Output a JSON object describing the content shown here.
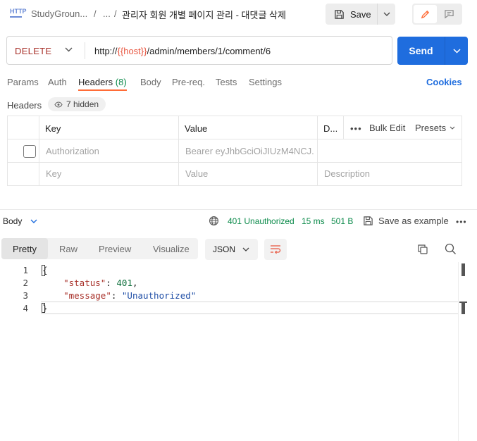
{
  "breadcrumb": {
    "http_badge": "HTTP",
    "collection": "StudyGroun...",
    "separator": "/",
    "ellipsis": "...",
    "request_title": "관리자 회원 개별 페이지 관리 - 대댓글 삭제"
  },
  "toolbar": {
    "save_label": "Save"
  },
  "request": {
    "method": "DELETE",
    "url_prefix": "http://",
    "url_variable": "{{host}}",
    "url_path": "/admin/members/1/comment/6",
    "send_label": "Send"
  },
  "request_tabs": {
    "params": "Params",
    "auth": "Auth",
    "headers": "Headers",
    "headers_count": "(8)",
    "body": "Body",
    "prereq": "Pre-req.",
    "tests": "Tests",
    "settings": "Settings",
    "cookies": "Cookies"
  },
  "headers_section": {
    "label": "Headers",
    "hidden_label": "7 hidden",
    "columns": {
      "key": "Key",
      "value": "Value",
      "description": "D...",
      "more": "•••",
      "bulk_edit": "Bulk Edit",
      "presets": "Presets"
    },
    "rows": [
      {
        "key": "Authorization",
        "value": "Bearer eyJhbGciOiJIUzM4NCJ...",
        "description": ""
      }
    ],
    "placeholder": {
      "key": "Key",
      "value": "Value",
      "description": "Description"
    }
  },
  "response": {
    "body_label": "Body",
    "status": "401 Unauthorized",
    "time": "15 ms",
    "size": "501 B",
    "save_example": "Save as example",
    "more": "•••",
    "view_tabs": {
      "pretty": "Pretty",
      "raw": "Raw",
      "preview": "Preview",
      "visualize": "Visualize"
    },
    "format": "JSON",
    "line_numbers": [
      "1",
      "2",
      "3",
      "4"
    ],
    "code": {
      "open_brace": "{",
      "status_key": "\"status\"",
      "status_value": "401",
      "message_key": "\"message\"",
      "message_value": "\"Unauthorized\"",
      "close_brace": "}"
    }
  },
  "colors": {
    "accent": "#ff6c37",
    "send": "#1f6dde",
    "method_delete": "#a8312a",
    "status_ok_text": "#0b8a4a",
    "variable": "#e8553f"
  }
}
